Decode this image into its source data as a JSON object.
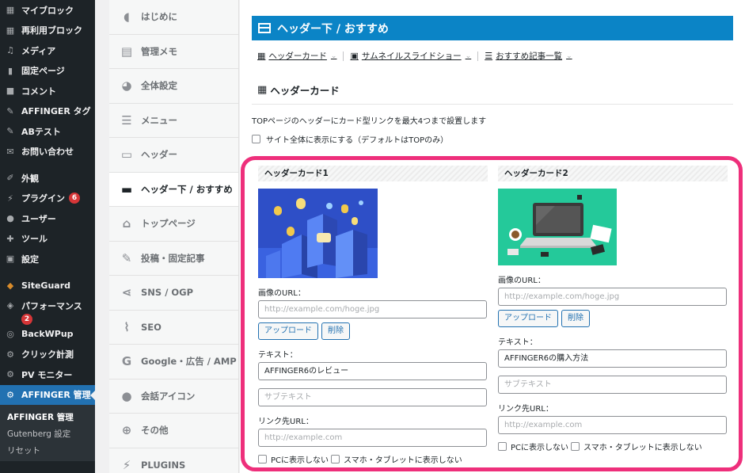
{
  "wp_menu": {
    "items": [
      {
        "label": "マイブロック",
        "icon": "grid-icon"
      },
      {
        "label": "再利用ブロック",
        "icon": "grid-icon"
      },
      {
        "label": "メディア",
        "icon": "media-icon"
      },
      {
        "label": "固定ページ",
        "icon": "page-icon"
      },
      {
        "label": "コメント",
        "icon": "comment-icon"
      },
      {
        "label": "AFFINGER タグ",
        "icon": "pin-icon"
      },
      {
        "label": "ABテスト",
        "icon": "pin-icon"
      },
      {
        "label": "お問い合わせ",
        "icon": "mail-icon"
      },
      {
        "label": "外観",
        "icon": "brush-icon"
      },
      {
        "label": "プラグイン",
        "icon": "plugin-icon",
        "badge": "6"
      },
      {
        "label": "ユーザー",
        "icon": "user-icon"
      },
      {
        "label": "ツール",
        "icon": "wrench-icon"
      },
      {
        "label": "設定",
        "icon": "settings-icon"
      },
      {
        "label": "SiteGuard",
        "icon": "guard-icon"
      },
      {
        "label": "パフォーマンス",
        "icon": "performance-icon",
        "badge": "2"
      },
      {
        "label": "BackWPup",
        "icon": "backup-icon"
      },
      {
        "label": "クリック計測",
        "icon": "gear-icon"
      },
      {
        "label": "PV モニター",
        "icon": "gear-icon"
      },
      {
        "label": "AFFINGER 管理",
        "icon": "gear-icon"
      }
    ],
    "submenu": [
      "AFFINGER 管理",
      "Gutenberg 設定",
      "リセット"
    ]
  },
  "settings_nav": [
    {
      "label": "はじめに",
      "icon": "shield-icon"
    },
    {
      "label": "管理メモ",
      "icon": "document-icon"
    },
    {
      "label": "全体設定",
      "icon": "palette-icon"
    },
    {
      "label": "メニュー",
      "icon": "menu-icon"
    },
    {
      "label": "ヘッダー",
      "icon": "header-icon"
    },
    {
      "label": "ヘッダー下 / おすすめ",
      "icon": "header-below-icon"
    },
    {
      "label": "トップページ",
      "icon": "home-icon"
    },
    {
      "label": "投稿・固定記事",
      "icon": "edit-icon"
    },
    {
      "label": "SNS / OGP",
      "icon": "share-icon"
    },
    {
      "label": "SEO",
      "icon": "chart-icon"
    },
    {
      "label": "Google・広告 / AMP",
      "icon": "google-icon"
    },
    {
      "label": "会話アイコン",
      "icon": "speech-icon"
    },
    {
      "label": "その他",
      "icon": "plus-icon"
    },
    {
      "label": "PLUGINS",
      "icon": "plugin-icon"
    }
  ],
  "main": {
    "section_title": "ヘッダー下 / おすすめ",
    "subtabs": [
      "ヘッダーカード",
      "サムネイルスライドショー",
      "おすすめ記事一覧"
    ],
    "card_section_heading": "ヘッダーカード",
    "description": "TOPページのヘッダーにカード型リンクを最大4つまで設置します",
    "sitewide_checkbox": "サイト全体に表示にする（デフォルトはTOPのみ）",
    "cards": [
      {
        "title": "ヘッダーカード1",
        "image_label": "画像のURL：",
        "image_url_placeholder": "http://example.com/hoge.jpg",
        "upload_button": "アップロード",
        "delete_button": "削除",
        "text_label": "テキスト：",
        "text_value": "AFFINGER6のレビュー",
        "subtext_placeholder": "サブテキスト",
        "link_label": "リンク先URL：",
        "link_placeholder": "http://example.com",
        "pc_hide": "PCに表示しない",
        "sp_hide": "スマホ・タブレットに表示しない"
      },
      {
        "title": "ヘッダーカード2",
        "image_label": "画像のURL：",
        "image_url_placeholder": "http://example.com/hoge.jpg",
        "upload_button": "アップロード",
        "delete_button": "削除",
        "text_label": "テキスト：",
        "text_value": "AFFINGER6の購入方法",
        "subtext_placeholder": "サブテキスト",
        "link_label": "リンク先URL：",
        "link_placeholder": "http://example.com",
        "pc_hide": "PCに表示しない",
        "sp_hide": "スマホ・タブレットに表示しない"
      }
    ]
  },
  "colors": {
    "wp_sidebar": "#1d2327",
    "wp_active": "#2271b1",
    "section_bar": "#0b84c6",
    "highlight": "#ee2f7b"
  }
}
